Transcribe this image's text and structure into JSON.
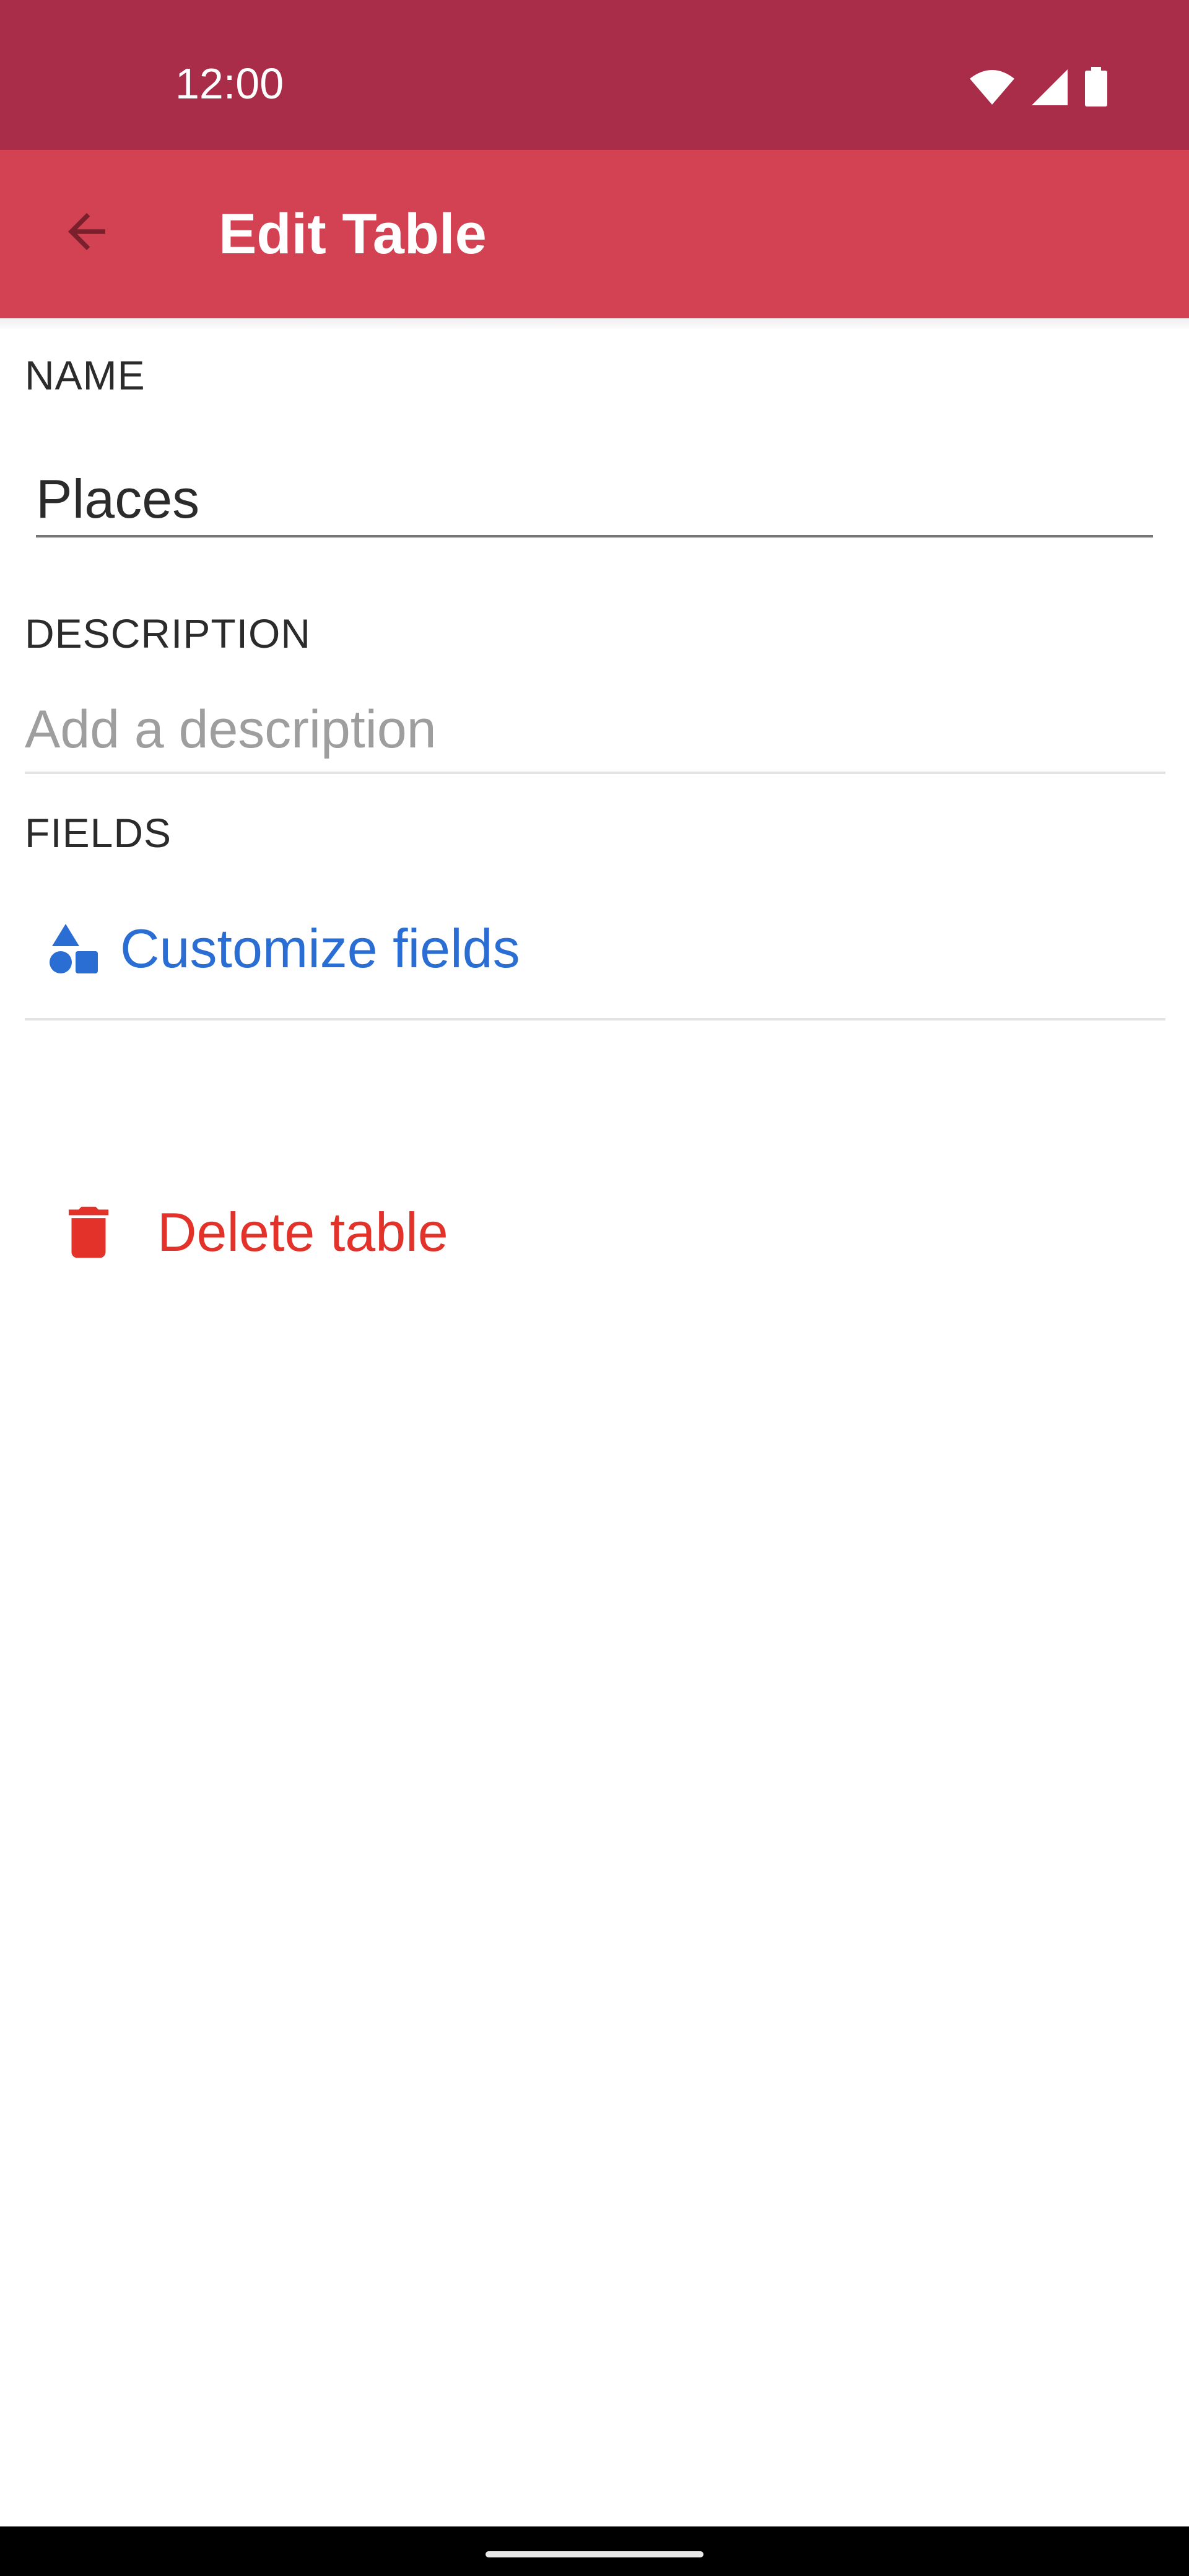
{
  "status_bar": {
    "time": "12:00",
    "icons": [
      "wifi-icon",
      "signal-icon",
      "battery-icon"
    ],
    "color": "#a92c48"
  },
  "app_bar": {
    "title": "Edit Table",
    "back_icon": "arrow-back-icon",
    "color": "#d34252"
  },
  "form": {
    "name": {
      "label": "NAME",
      "value": "Places"
    },
    "description": {
      "label": "DESCRIPTION",
      "value": "",
      "placeholder": "Add a description"
    },
    "fields": {
      "label": "FIELDS",
      "customize_label": "Customize fields",
      "customize_icon": "shapes-icon",
      "accent_color": "#2a6ed3"
    }
  },
  "delete": {
    "label": "Delete table",
    "icon": "trash-icon",
    "color": "#e2322a"
  },
  "nav_bar": {
    "handle": "gesture-handle"
  }
}
